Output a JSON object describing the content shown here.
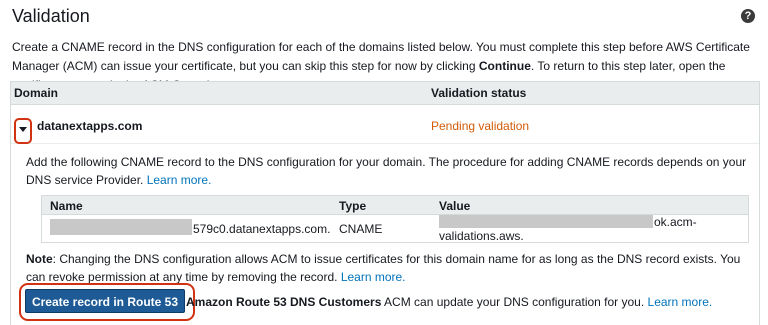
{
  "header": {
    "title": "Validation",
    "help_icon": "?"
  },
  "intro": {
    "text_before": "Create a CNAME record in the DNS configuration for each of the domains listed below. You must complete this step before AWS Certificate Manager (ACM) can issue your certificate, but you can skip this step for now by clicking ",
    "bold": "Continue",
    "text_after": ". To return to this step later, open the certificate request in the ACM Console."
  },
  "table": {
    "col_domain": "Domain",
    "col_status": "Validation status",
    "row": {
      "domain": "datanextapps.com",
      "status": "Pending validation",
      "status_color": "#d45b07"
    }
  },
  "detail": {
    "text": "Add the following CNAME record to the DNS configuration for your domain. The procedure for adding CNAME records depends on your DNS service Provider. ",
    "learn_more": "Learn more.",
    "record_table": {
      "col_name": "Name",
      "col_type": "Type",
      "col_value": "Value",
      "name": "579c0.datanextapps.com.",
      "type": "CNAME",
      "value_part1": "ok.acm-",
      "value_part2": "validations.aws."
    },
    "note_label": "Note",
    "note_text": ": Changing the DNS configuration allows ACM to issue certificates for this domain name for as long as the DNS record exists. You can revoke permission at any time by removing the record. ",
    "note_link": "Learn more."
  },
  "action": {
    "button_label": "Create record in Route 53",
    "desc_bold": "Amazon Route 53 DNS Customers",
    "desc_text": " ACM can update your DNS configuration for you. ",
    "desc_link": "Learn more."
  },
  "colors": {
    "button_bg": "#1d5a96",
    "link": "#0073bb",
    "highlight_ring": "#d13212"
  }
}
